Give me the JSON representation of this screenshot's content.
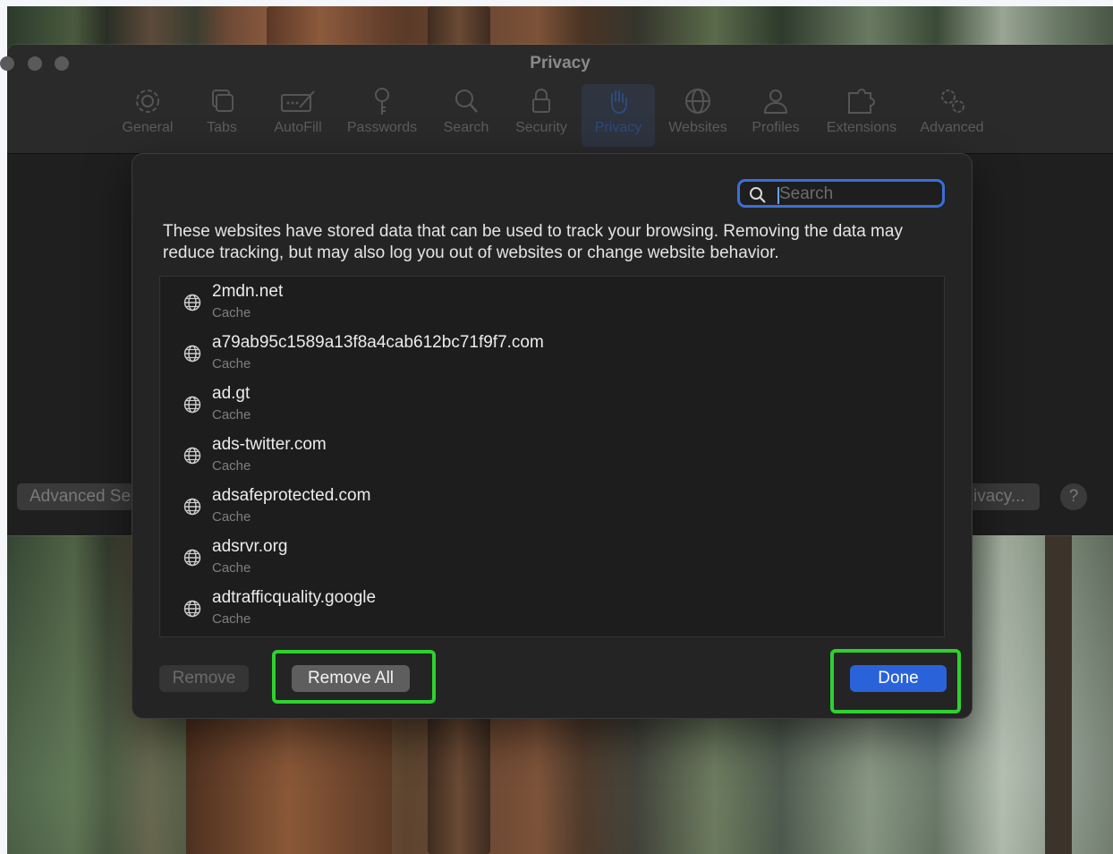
{
  "window": {
    "title": "Privacy",
    "tabs": [
      {
        "label": "General",
        "icon": "gear-icon"
      },
      {
        "label": "Tabs",
        "icon": "tabs-icon"
      },
      {
        "label": "AutoFill",
        "icon": "autofill-icon"
      },
      {
        "label": "Passwords",
        "icon": "key-icon"
      },
      {
        "label": "Search",
        "icon": "search-icon"
      },
      {
        "label": "Security",
        "icon": "lock-icon"
      },
      {
        "label": "Privacy",
        "icon": "hand-icon",
        "active": true
      },
      {
        "label": "Websites",
        "icon": "globe-icon"
      },
      {
        "label": "Profiles",
        "icon": "person-icon"
      },
      {
        "label": "Extensions",
        "icon": "puzzle-icon"
      },
      {
        "label": "Advanced",
        "icon": "gears-icon"
      }
    ],
    "background_buttons": {
      "left_label": "Advanced Se",
      "right_label": "ivacy...",
      "help_label": "?"
    }
  },
  "sheet": {
    "search": {
      "placeholder": "Search",
      "value": ""
    },
    "description": "These websites have stored data that can be used to track your browsing. Removing the data may reduce tracking, but may also log you out of websites or change website behavior.",
    "websites": [
      {
        "site": "2mdn.net",
        "type": "Cache"
      },
      {
        "site": "a79ab95c1589a13f8a4cab612bc71f9f7.com",
        "type": "Cache"
      },
      {
        "site": "ad.gt",
        "type": "Cache"
      },
      {
        "site": "ads-twitter.com",
        "type": "Cache"
      },
      {
        "site": "adsafeprotected.com",
        "type": "Cache"
      },
      {
        "site": "adsrvr.org",
        "type": "Cache"
      },
      {
        "site": "adtrafficquality.google",
        "type": "Cache"
      }
    ],
    "buttons": {
      "remove": "Remove",
      "remove_all": "Remove All",
      "done": "Done"
    }
  },
  "colors": {
    "accent": "#2a63d9",
    "highlight": "#2fd12f",
    "focus_ring": "#3a6fd8"
  }
}
